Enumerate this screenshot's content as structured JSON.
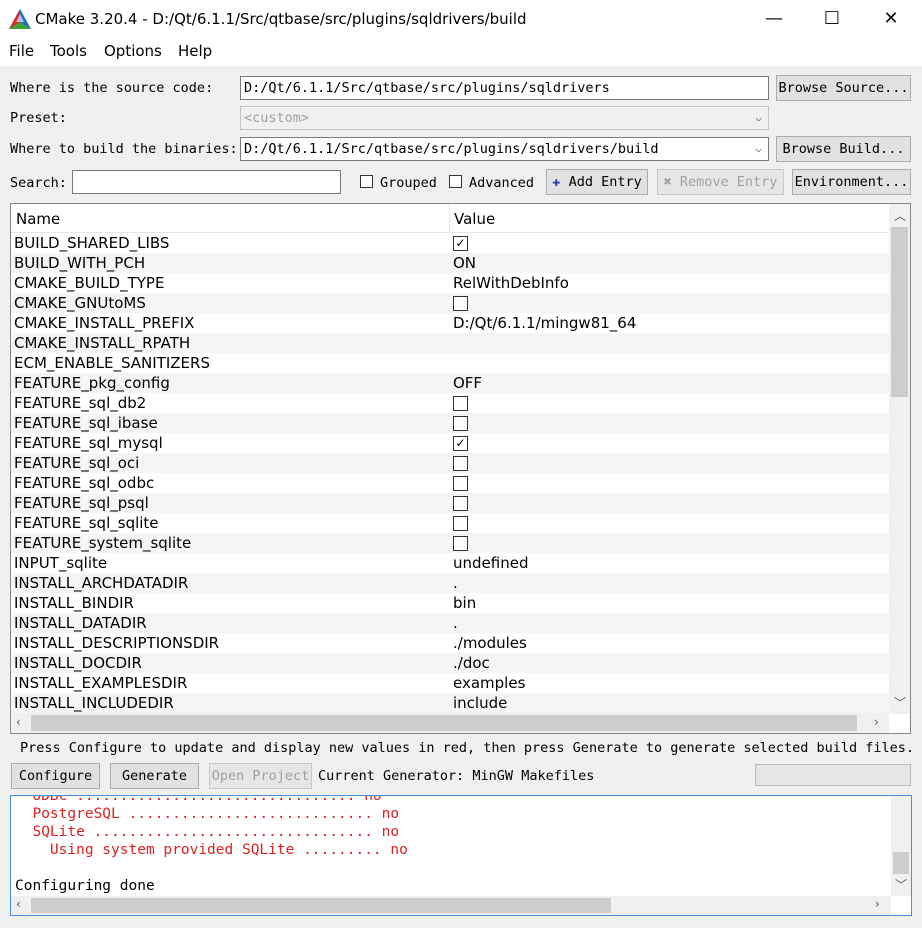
{
  "window": {
    "title": "CMake 3.20.4 - D:/Qt/6.1.1/Src/qtbase/src/plugins/sqldrivers/build",
    "minimize_glyph": "—",
    "maximize_glyph": "☐",
    "close_glyph": "✕"
  },
  "menu": {
    "items": [
      "File",
      "Tools",
      "Options",
      "Help"
    ]
  },
  "source": {
    "label": "Where is the source code:",
    "value": "D:/Qt/6.1.1/Src/qtbase/src/plugins/sqldrivers",
    "button": "Browse Source..."
  },
  "preset": {
    "label": "Preset:",
    "value": "<custom>"
  },
  "build": {
    "label": "Where to build the binaries:",
    "value": "D:/Qt/6.1.1/Src/qtbase/src/plugins/sqldrivers/build",
    "button": "Browse Build..."
  },
  "toolbar": {
    "search_label": "Search:",
    "search_value": "",
    "grouped_label": "Grouped",
    "advanced_label": "Advanced",
    "add_entry": "Add Entry",
    "remove_entry": "Remove Entry",
    "environment": "Environment..."
  },
  "table": {
    "headers": {
      "name": "Name",
      "value": "Value"
    },
    "rows": [
      {
        "name": "BUILD_SHARED_LIBS",
        "type": "bool",
        "checked": true
      },
      {
        "name": "BUILD_WITH_PCH",
        "type": "text",
        "value": "ON"
      },
      {
        "name": "CMAKE_BUILD_TYPE",
        "type": "text",
        "value": "RelWithDebInfo"
      },
      {
        "name": "CMAKE_GNUtoMS",
        "type": "bool",
        "checked": false
      },
      {
        "name": "CMAKE_INSTALL_PREFIX",
        "type": "text",
        "value": "D:/Qt/6.1.1/mingw81_64"
      },
      {
        "name": "CMAKE_INSTALL_RPATH",
        "type": "text",
        "value": ""
      },
      {
        "name": "ECM_ENABLE_SANITIZERS",
        "type": "text",
        "value": ""
      },
      {
        "name": "FEATURE_pkg_config",
        "type": "text",
        "value": "OFF"
      },
      {
        "name": "FEATURE_sql_db2",
        "type": "bool",
        "checked": false
      },
      {
        "name": "FEATURE_sql_ibase",
        "type": "bool",
        "checked": false
      },
      {
        "name": "FEATURE_sql_mysql",
        "type": "bool",
        "checked": true
      },
      {
        "name": "FEATURE_sql_oci",
        "type": "bool",
        "checked": false
      },
      {
        "name": "FEATURE_sql_odbc",
        "type": "bool",
        "checked": false
      },
      {
        "name": "FEATURE_sql_psql",
        "type": "bool",
        "checked": false
      },
      {
        "name": "FEATURE_sql_sqlite",
        "type": "bool",
        "checked": false
      },
      {
        "name": "FEATURE_system_sqlite",
        "type": "bool",
        "checked": false
      },
      {
        "name": "INPUT_sqlite",
        "type": "text",
        "value": "undefined"
      },
      {
        "name": "INSTALL_ARCHDATADIR",
        "type": "text",
        "value": "."
      },
      {
        "name": "INSTALL_BINDIR",
        "type": "text",
        "value": "bin"
      },
      {
        "name": "INSTALL_DATADIR",
        "type": "text",
        "value": "."
      },
      {
        "name": "INSTALL_DESCRIPTIONSDIR",
        "type": "text",
        "value": "./modules"
      },
      {
        "name": "INSTALL_DOCDIR",
        "type": "text",
        "value": "./doc"
      },
      {
        "name": "INSTALL_EXAMPLESDIR",
        "type": "text",
        "value": "examples"
      },
      {
        "name": "INSTALL_INCLUDEDIR",
        "type": "text",
        "value": "include"
      }
    ]
  },
  "hint": "Press Configure to update and display new values in red, then press Generate to generate selected build files.",
  "actions": {
    "configure": "Configure",
    "generate": "Generate",
    "open_project": "Open Project",
    "generator_label": "Current Generator: MinGW Makefiles"
  },
  "output": {
    "lines": [
      {
        "text": "  ODBC ................................ no",
        "color": "#e02020"
      },
      {
        "text": "  PostgreSQL ............................ no",
        "color": "#e02020"
      },
      {
        "text": "  SQLite ................................ no",
        "color": "#e02020"
      },
      {
        "text": "    Using system provided SQLite ......... no",
        "color": "#e02020"
      },
      {
        "text": "",
        "color": "#000000"
      },
      {
        "text": "Configuring done",
        "color": "#000000"
      }
    ]
  },
  "colors": {
    "accent": "#4a90d9",
    "error_text": "#e02020"
  }
}
